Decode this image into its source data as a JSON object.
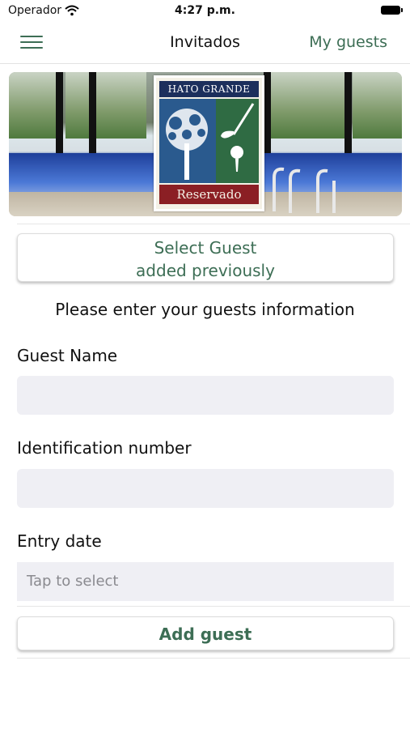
{
  "status_bar": {
    "carrier": "Operador",
    "time": "4:27 p.m."
  },
  "nav": {
    "title": "Invitados",
    "action": "My guests"
  },
  "banner": {
    "logo_top": "HATO GRANDE",
    "logo_bottom": "Reservado"
  },
  "select_guest": {
    "line1": "Select Guest",
    "line2": "added previously"
  },
  "instructions": "Please enter your guests information",
  "form": {
    "guest_name_label": "Guest Name",
    "guest_name_value": "",
    "id_label": "Identification number",
    "id_value": "",
    "entry_date_label": "Entry date",
    "entry_date_placeholder": "Tap to select"
  },
  "add_guest_label": "Add guest",
  "colors": {
    "accent": "#3d6e55",
    "input_bg": "#efeff4"
  }
}
